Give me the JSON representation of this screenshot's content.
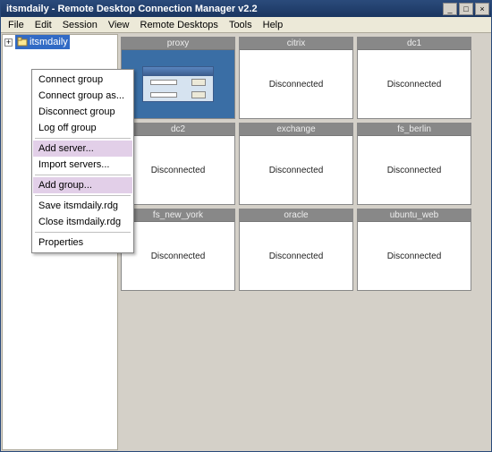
{
  "titlebar": {
    "title": "itsmdaily - Remote Desktop Connection Manager v2.2",
    "min_glyph": "_",
    "max_glyph": "□",
    "close_glyph": "×"
  },
  "menubar": {
    "file": "File",
    "edit": "Edit",
    "session": "Session",
    "view": "View",
    "remote_desktops": "Remote Desktops",
    "tools": "Tools",
    "help": "Help"
  },
  "tree": {
    "expander_glyph": "+",
    "root_label": "itsmdaily"
  },
  "context_menu": {
    "connect_group": "Connect group",
    "connect_group_as": "Connect group as...",
    "disconnect_group": "Disconnect group",
    "log_off_group": "Log off group",
    "add_server": "Add server...",
    "import_servers": "Import servers...",
    "add_group": "Add group...",
    "save_rdg": "Save itsmdaily.rdg",
    "close_rdg": "Close itsmdaily.rdg",
    "properties": "Properties"
  },
  "servers": [
    {
      "name": "proxy",
      "status": "Connected",
      "connected": true
    },
    {
      "name": "citrix",
      "status": "Disconnected",
      "connected": false
    },
    {
      "name": "dc1",
      "status": "Disconnected",
      "connected": false
    },
    {
      "name": "dc2",
      "status": "Disconnected",
      "connected": false
    },
    {
      "name": "exchange",
      "status": "Disconnected",
      "connected": false
    },
    {
      "name": "fs_berlin",
      "status": "Disconnected",
      "connected": false
    },
    {
      "name": "fs_new_york",
      "status": "Disconnected",
      "connected": false
    },
    {
      "name": "oracle",
      "status": "Disconnected",
      "connected": false
    },
    {
      "name": "ubuntu_web",
      "status": "Disconnected",
      "connected": false
    }
  ]
}
